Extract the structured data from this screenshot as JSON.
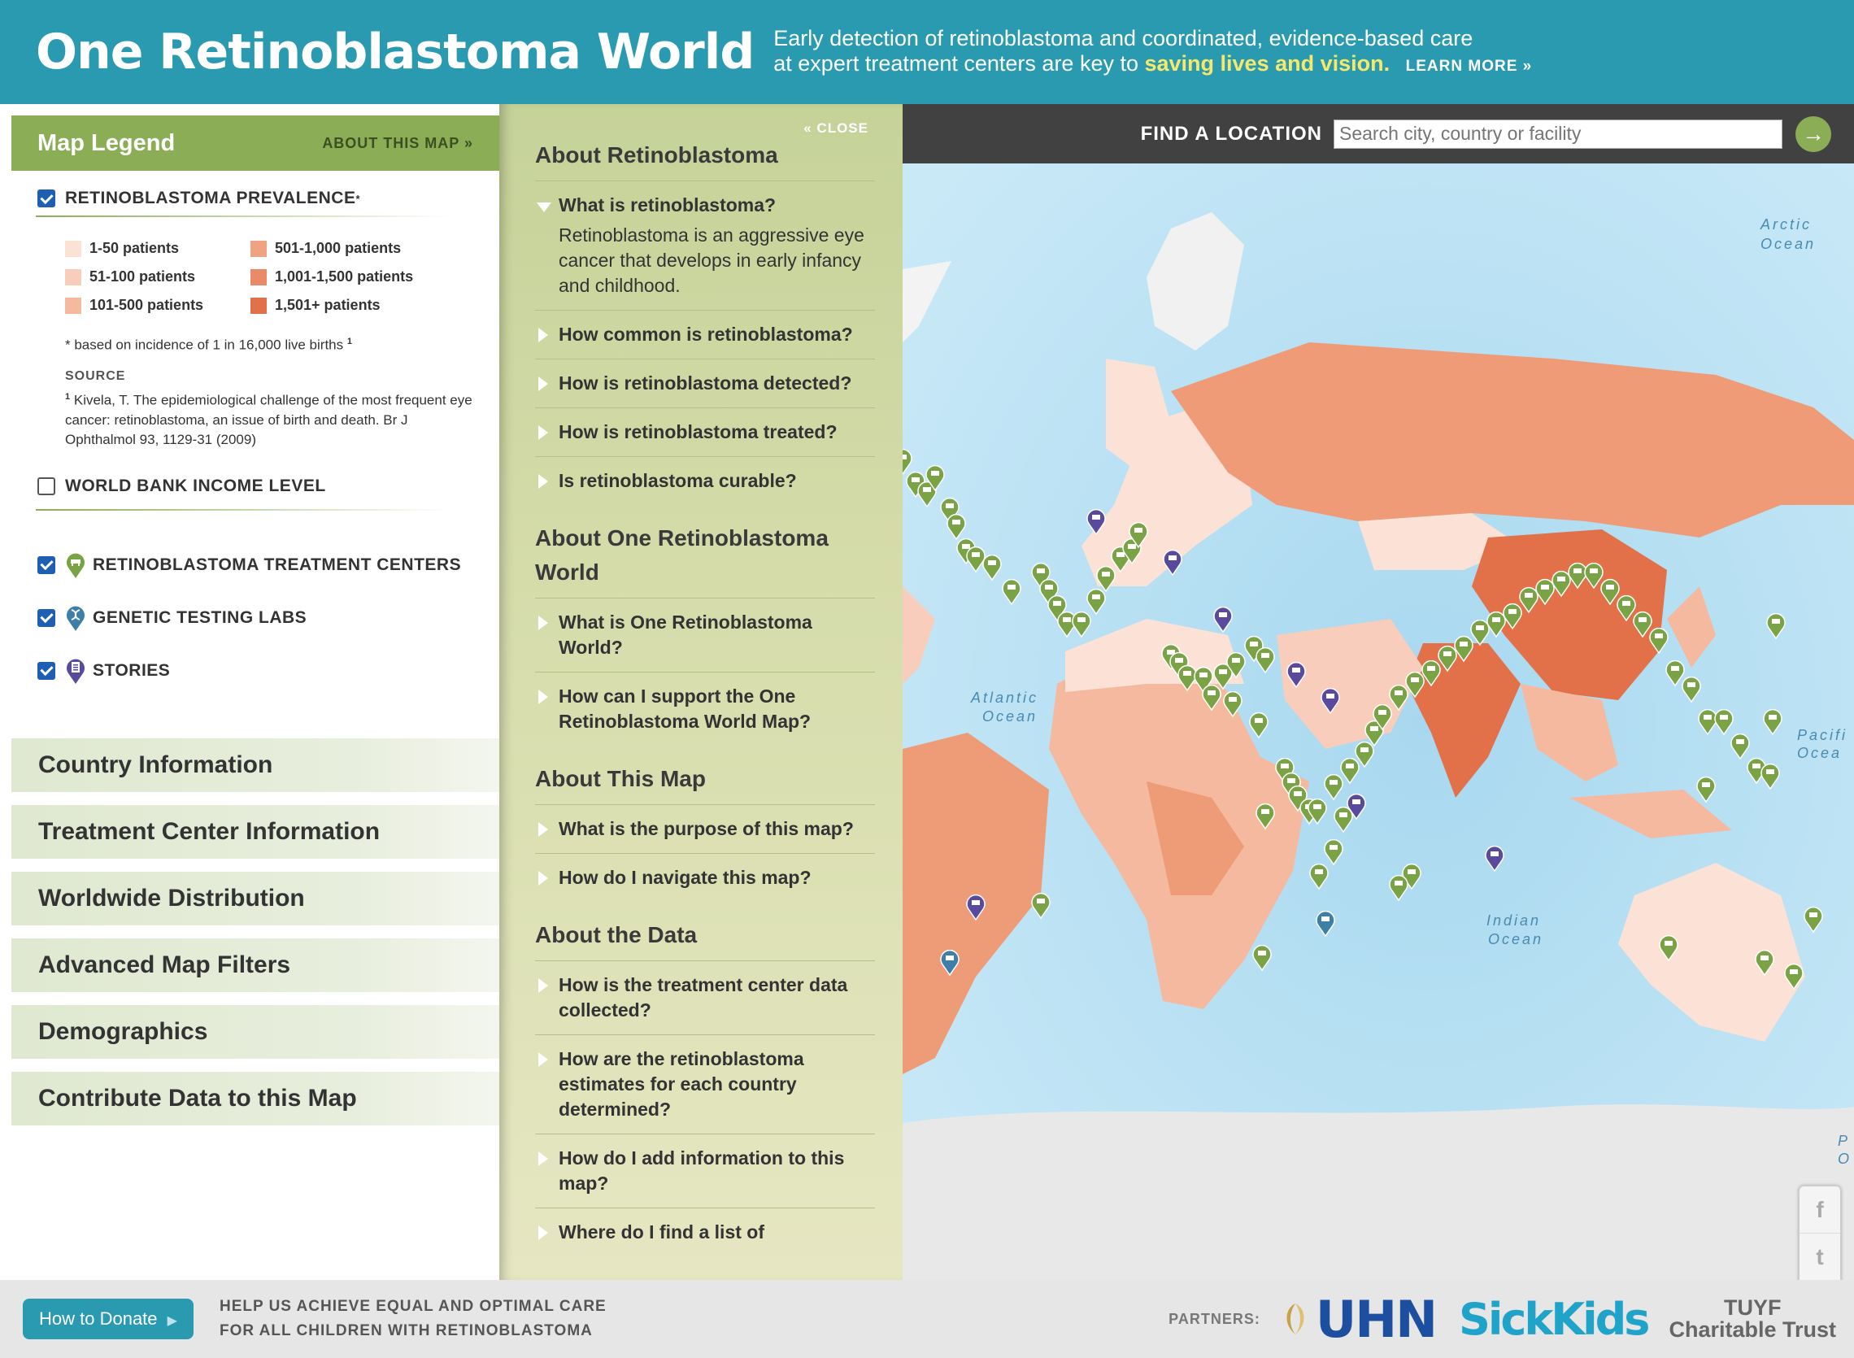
{
  "header": {
    "title": "One Retinoblastoma World",
    "tagline_line1": "Early detection of retinoblastoma and coordinated, evidence-based care",
    "tagline_line2": "at expert treatment centers are key to",
    "tagline_highlight": "saving lives and vision.",
    "learn_more": "LEARN MORE »"
  },
  "legend": {
    "title": "Map Legend",
    "about_link": "ABOUT THIS MAP »",
    "prevalence": {
      "label": "RETINOBLASTOMA PREVALENCE",
      "mark": "*",
      "checked": true,
      "items": [
        {
          "label": "1-50 patients",
          "color": "#fbe1d6"
        },
        {
          "label": "501-1,000 patients",
          "color": "#f0a383"
        },
        {
          "label": "51-100 patients",
          "color": "#f8cdbb"
        },
        {
          "label": "1,001-1,500 patients",
          "color": "#ea8a66"
        },
        {
          "label": "101-500 patients",
          "color": "#f5b9a0"
        },
        {
          "label": "1,501+ patients",
          "color": "#e2714a"
        }
      ],
      "footnote": "* based on incidence of 1 in 16,000 live births",
      "footnote_ref": "1",
      "source_label": "SOURCE",
      "source_ref": "1",
      "source_text": "Kivela, T. The epidemiological challenge of the most frequent eye cancer: retinoblastoma, an issue of birth and death. Br J Ophthalmol 93, 1129-31 (2009)"
    },
    "income": {
      "label": "WORLD BANK INCOME LEVEL",
      "checked": false
    },
    "layers": [
      {
        "label": "RETINOBLASTOMA TREATMENT CENTERS",
        "checked": true,
        "icon": "treatment-center-pin-icon",
        "color": "#7aa345"
      },
      {
        "label": "GENETIC TESTING LABS",
        "checked": true,
        "icon": "dna-pin-icon",
        "color": "#3d7fa6"
      },
      {
        "label": "STORIES",
        "checked": true,
        "icon": "story-pin-icon",
        "color": "#5a4a9e"
      }
    ]
  },
  "accordions": [
    "Country Information",
    "Treatment Center Information",
    "Worldwide Distribution",
    "Advanced Map Filters",
    "Demographics",
    "Contribute Data to this Map"
  ],
  "info_panel": {
    "close_label": "« CLOSE",
    "sections": [
      {
        "title": "About Retinoblastoma",
        "questions": [
          {
            "q": "What is retinoblastoma?",
            "open": true,
            "a": "Retinoblastoma is an aggressive eye cancer that develops in early infancy and childhood."
          },
          {
            "q": "How common is retinoblastoma?"
          },
          {
            "q": "How is retinoblastoma detected?"
          },
          {
            "q": "How is retinoblastoma treated?"
          },
          {
            "q": "Is retinoblastoma curable?"
          }
        ]
      },
      {
        "title": "About One Retinoblastoma World",
        "questions": [
          {
            "q": "What is One Retinoblastoma World?"
          },
          {
            "q": "How can I support the One Retinoblastoma World Map?"
          }
        ]
      },
      {
        "title": "About This Map",
        "questions": [
          {
            "q": "What is the purpose of this map?"
          },
          {
            "q": "How do I navigate this map?"
          }
        ]
      },
      {
        "title": "About the Data",
        "questions": [
          {
            "q": "How is the treatment center data collected?"
          },
          {
            "q": "How are the retinoblastoma estimates for each country determined?"
          },
          {
            "q": "How do I add information to this map?"
          },
          {
            "q": "Where do I find a list of"
          }
        ]
      }
    ]
  },
  "find": {
    "label": "FIND A LOCATION",
    "placeholder": "Search city, country or facility",
    "go": "→"
  },
  "map_labels": {
    "arctic": [
      "Arctic",
      "Ocean"
    ],
    "atlantic": [
      "Atlantic",
      "Ocean"
    ],
    "indian": [
      "Indian",
      "Ocean"
    ],
    "pacific": [
      "Pacifi",
      "Ocea"
    ],
    "pacific2": [
      "P",
      "O"
    ]
  },
  "share": [
    "f",
    "t",
    "✉"
  ],
  "footer": {
    "donate": "How to Donate",
    "donate_arrow": "▶",
    "message_line1": "HELP US ACHIEVE EQUAL AND OPTIMAL CARE",
    "message_line2": "FOR ALL CHILDREN WITH RETINOBLASTOMA",
    "partners_label": "PARTNERS:",
    "partner_uhn": "UHN",
    "partner_sickkids": "SickKids",
    "partner_tuyf_line1": "TUYF",
    "partner_tuyf_line2": "Charitable Trust"
  }
}
